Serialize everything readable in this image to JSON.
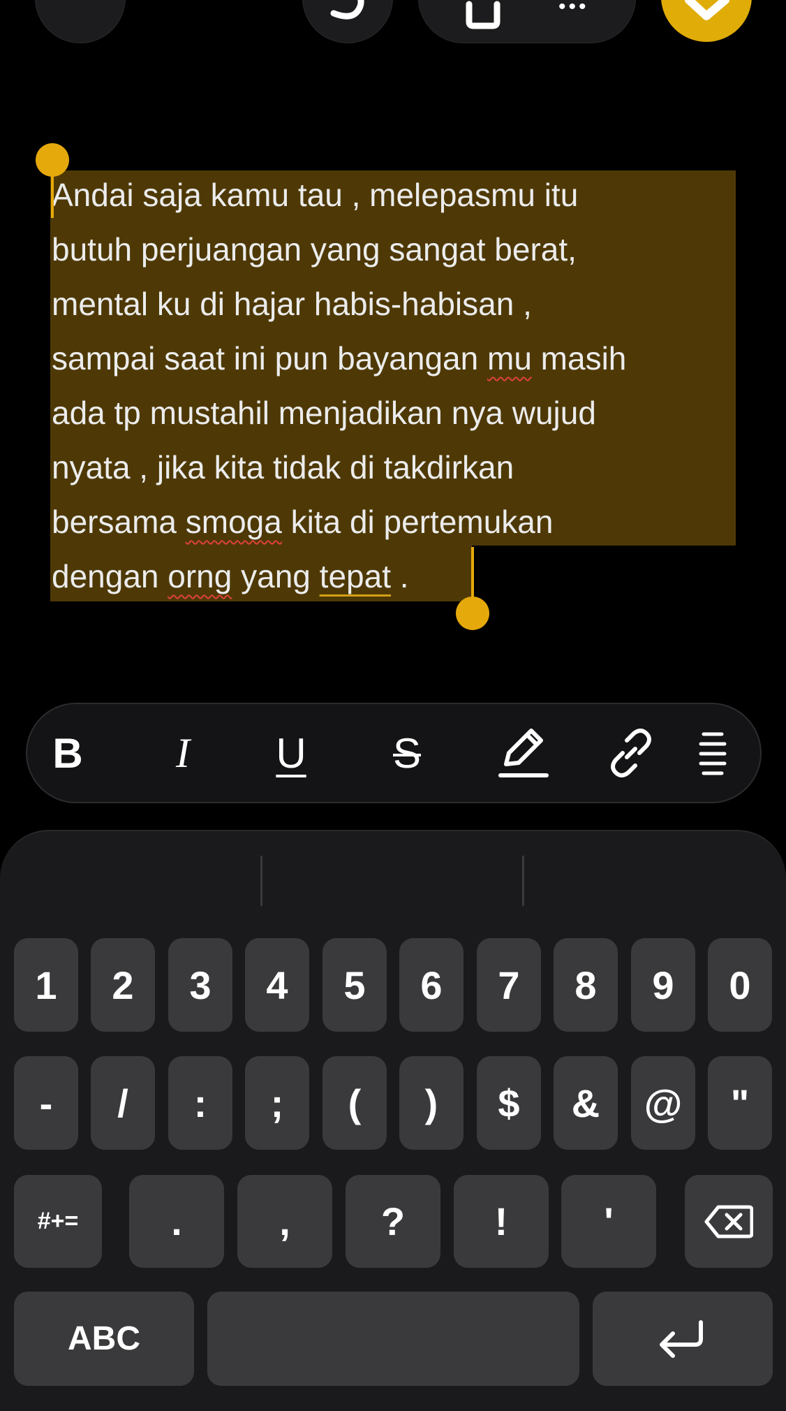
{
  "toolbar": {
    "back_icon": "chevron-left-icon",
    "undo_icon": "undo-icon",
    "save_icon": "save-icon",
    "more_label": "•••",
    "done_icon": "check-icon",
    "accent_color": "#e0ac08"
  },
  "note": {
    "lines": [
      [
        {
          "t": "Andai saja kamu tau , melepasmu itu"
        }
      ],
      [
        {
          "t": "butuh perjuangan yang sangat berat,"
        }
      ],
      [
        {
          "t": "mental ku di hajar habis-habisan ,"
        }
      ],
      [
        {
          "t": "sampai saat ini pun bayangan "
        },
        {
          "t": "mu",
          "spell": true
        },
        {
          "t": " masih"
        }
      ],
      [
        {
          "t": "ada tp mustahil menjadikan nya wujud"
        }
      ],
      [
        {
          "t": "nyata , jika kita tidak di takdirkan"
        }
      ],
      [
        {
          "t": "bersama "
        },
        {
          "t": "smoga",
          "spell": true
        },
        {
          "t": " kita di pertemukan"
        }
      ],
      [
        {
          "t": "dengan "
        },
        {
          "t": "orng",
          "spell": true
        },
        {
          "t": " yang "
        },
        {
          "t": "tepat",
          "underline": true
        },
        {
          "t": " ."
        }
      ]
    ],
    "selection_color": "#4e3906",
    "handle_color": "#e6a90b"
  },
  "format_bar": {
    "bold_label": "B",
    "italic_label": "I",
    "underline_label": "U",
    "strike_label": "S",
    "icons": [
      "highlight-pen-icon",
      "link-icon",
      "align-icon"
    ]
  },
  "keyboard": {
    "row1": [
      "1",
      "2",
      "3",
      "4",
      "5",
      "6",
      "7",
      "8",
      "9",
      "0"
    ],
    "row2": [
      "-",
      "/",
      ":",
      ";",
      "(",
      ")",
      "$",
      "&",
      "@",
      "\""
    ],
    "row3": [
      "#+=",
      ".",
      ",",
      "?",
      "!",
      "'"
    ],
    "backspace_icon": "backspace-icon",
    "abc_label": "ABC",
    "space_label": "",
    "return_icon": "return-icon"
  }
}
